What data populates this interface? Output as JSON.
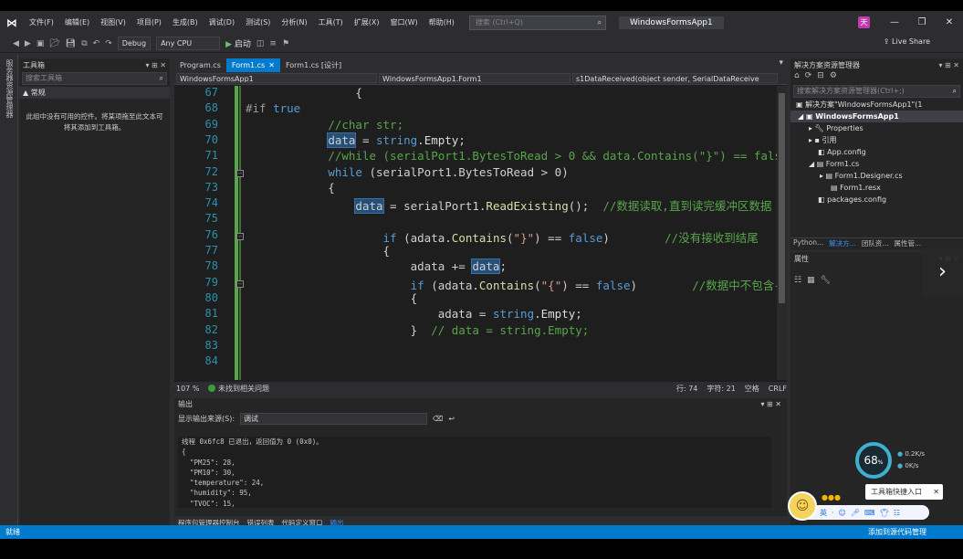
{
  "titlebar": {
    "menus": [
      "文件(F)",
      "编辑(E)",
      "视图(V)",
      "项目(P)",
      "生成(B)",
      "调试(D)",
      "测试(S)",
      "分析(N)",
      "工具(T)",
      "扩展(X)",
      "窗口(W)",
      "帮助(H)"
    ],
    "search_placeholder": "搜索 (Ctrl+Q)",
    "app_title": "WindowsFormsApp1",
    "avatar": "天"
  },
  "toolbar": {
    "config": "Debug",
    "platform": "Any CPU",
    "run_label": "启动",
    "live_share": "Live Share"
  },
  "toolbox": {
    "title": "工具箱",
    "search": "搜索工具箱",
    "group": "▲ 常规",
    "empty_text": "此组中没有可用的控件。将某项拖至此文本可将其添加到工具箱。",
    "strip_label": "服务器资源管理器"
  },
  "editor": {
    "tabs": [
      "Program.cs",
      "Form1.cs",
      "Form1.cs [设计]"
    ],
    "nav": [
      "WindowsFormsApp1",
      "WindowsFormsApp1.Form1",
      "s1DataReceived(object sender, SerialDataReceive"
    ],
    "zoom": "107 %",
    "issues": "未找到相关问题",
    "position": "行: 74",
    "col": "字符: 21",
    "mode": "空格",
    "eol": "CRLF"
  },
  "code": {
    "lines": [
      {
        "n": "67",
        "t": "                {"
      },
      {
        "n": "68",
        "t": "#if true"
      },
      {
        "n": "69",
        "t": "            //char str;"
      },
      {
        "n": "70",
        "t": "            data = string.Empty;"
      },
      {
        "n": "71",
        "t": "            //while (serialPort1.BytesToRead > 0 && data.Contains(\"}\") == false)"
      },
      {
        "n": "72",
        "t": "            while (serialPort1.BytesToRead > 0)"
      },
      {
        "n": "73",
        "t": "            {"
      },
      {
        "n": "74",
        "t": "                data = serialPort1.ReadExisting();  //数据读取,直到读完缓冲区数据"
      },
      {
        "n": "75",
        "t": ""
      },
      {
        "n": "76",
        "t": "                    if (adata.Contains(\"}\") == false)        //没有接收到结尾"
      },
      {
        "n": "77",
        "t": "                    {"
      },
      {
        "n": "78",
        "t": "                        adata += data;"
      },
      {
        "n": "79",
        "t": "                        if (adata.Contains(\"{\") == false)        //数据中不包含{"
      },
      {
        "n": "80",
        "t": "                        {"
      },
      {
        "n": "81",
        "t": "                            adata = string.Empty;"
      },
      {
        "n": "82",
        "t": "                        }  // data = string.Empty;"
      },
      {
        "n": "83",
        "t": ""
      },
      {
        "n": "84",
        "t": ""
      }
    ]
  },
  "output": {
    "title": "输出",
    "source_label": "显示输出来源(S):",
    "source": "调试",
    "lines": [
      "线程 0x6fc8 已退出，返回值为 0 (0x0)。",
      "{",
      "  \"PM25\": 28,",
      "  \"PM10\": 30,",
      "  \"temperature\": 24,",
      "  \"humidity\": 95,",
      "  \"TVOC\": 15,"
    ]
  },
  "bottom_tabs": [
    "程序包管理器控制台",
    "错误列表",
    "代码定义窗口",
    "输出"
  ],
  "solution": {
    "title": "解决方案资源管理器",
    "search": "搜索解决方案资源管理器(Ctrl+;)",
    "tree": [
      "解决方案\"WindowsFormsApp1\"(1",
      "WindowsFormsApp1",
      "Properties",
      "引用",
      "App.config",
      "Form1.cs",
      "Form1.Designer.cs",
      "Form1.resx",
      "packages.config"
    ],
    "tabs": [
      "Python...",
      "解决方...",
      "团队资...",
      "属性管..."
    ]
  },
  "properties": {
    "title": "属性"
  },
  "status": {
    "left": "就绪",
    "right": "添加到源代码管理"
  },
  "overlay": {
    "gauge": "68",
    "gauge_unit": "%",
    "up": "0.2",
    "up_unit": "K/s",
    "down": "0",
    "down_unit": "K/s",
    "tip": "工具箱快捷入口",
    "arrow": "›"
  }
}
